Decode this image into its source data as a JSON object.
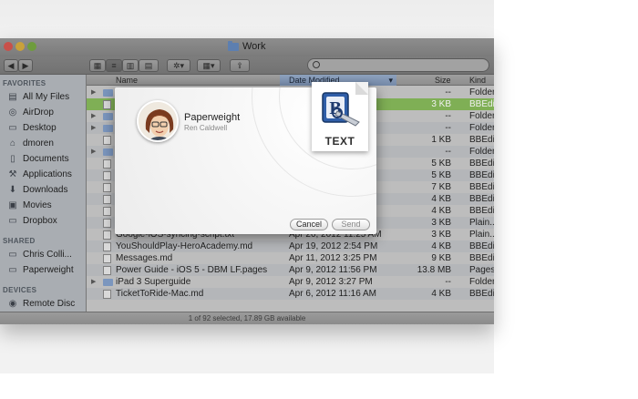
{
  "window": {
    "title": "Work"
  },
  "sidebar": {
    "sections": [
      {
        "heading": "FAVORITES",
        "items": [
          {
            "label": "All My Files",
            "icon": "all-files-icon"
          },
          {
            "label": "AirDrop",
            "icon": "airdrop-icon"
          },
          {
            "label": "Desktop",
            "icon": "desktop-icon"
          },
          {
            "label": "dmoren",
            "icon": "home-icon"
          },
          {
            "label": "Documents",
            "icon": "documents-icon"
          },
          {
            "label": "Applications",
            "icon": "applications-icon"
          },
          {
            "label": "Downloads",
            "icon": "downloads-icon"
          },
          {
            "label": "Movies",
            "icon": "movies-icon"
          },
          {
            "label": "Dropbox",
            "icon": "dropbox-icon"
          }
        ]
      },
      {
        "heading": "SHARED",
        "items": [
          {
            "label": "Chris Colli...",
            "icon": "computer-icon"
          },
          {
            "label": "Paperweight",
            "icon": "computer-icon"
          }
        ]
      },
      {
        "heading": "DEVICES",
        "items": [
          {
            "label": "Remote Disc",
            "icon": "disc-icon"
          }
        ]
      }
    ]
  },
  "columns": {
    "name": "Name",
    "date": "Date Modified",
    "size": "Size",
    "kind": "Kind"
  },
  "rows": [
    {
      "name": "",
      "date": "",
      "size": "--",
      "kind": "Folder",
      "type": "folder",
      "state": ""
    },
    {
      "name": "",
      "date": "",
      "size": "3 KB",
      "kind": "BBEdit",
      "type": "file",
      "state": "sel"
    },
    {
      "name": "",
      "date": "",
      "size": "--",
      "kind": "Folder",
      "type": "folder",
      "state": ""
    },
    {
      "name": "",
      "date": "",
      "size": "--",
      "kind": "Folder",
      "type": "folder",
      "state": ""
    },
    {
      "name": "",
      "date": "",
      "size": "1 KB",
      "kind": "BBEdit",
      "type": "file",
      "state": ""
    },
    {
      "name": "",
      "date": "",
      "size": "--",
      "kind": "Folder",
      "type": "folder",
      "state": ""
    },
    {
      "name": "",
      "date": "",
      "size": "5 KB",
      "kind": "BBEdit",
      "type": "file",
      "state": ""
    },
    {
      "name": "",
      "date": "",
      "size": "5 KB",
      "kind": "BBEdit",
      "type": "file",
      "state": ""
    },
    {
      "name": "",
      "date": "",
      "size": "7 KB",
      "kind": "BBEdit",
      "type": "file",
      "state": ""
    },
    {
      "name": "",
      "date": "",
      "size": "4 KB",
      "kind": "BBEdit",
      "type": "file",
      "state": ""
    },
    {
      "name": "",
      "date": "",
      "size": "4 KB",
      "kind": "BBEdit",
      "type": "file",
      "state": ""
    },
    {
      "name": "",
      "date": "",
      "size": "3 KB",
      "kind": "Plain...",
      "type": "file",
      "state": ""
    },
    {
      "name": "Google-iOS-syncing-script.txt",
      "date": "Apr 26, 2012 11:25 AM",
      "size": "3 KB",
      "kind": "Plain...",
      "type": "file",
      "state": ""
    },
    {
      "name": "YouShouldPlay-HeroAcademy.md",
      "date": "Apr 19, 2012 2:54 PM",
      "size": "4 KB",
      "kind": "BBEdit",
      "type": "file",
      "state": ""
    },
    {
      "name": "Messages.md",
      "date": "Apr 11, 2012 3:25 PM",
      "size": "9 KB",
      "kind": "BBEdit",
      "type": "file",
      "state": ""
    },
    {
      "name": "Power Guide - iOS 5 - DBM LF.pages",
      "date": "Apr 9, 2012 11:56 PM",
      "size": "13.8 MB",
      "kind": "Pages",
      "type": "file",
      "state": ""
    },
    {
      "name": "iPad 3 Superguide",
      "date": "Apr 9, 2012 3:27 PM",
      "size": "--",
      "kind": "Folder",
      "type": "folder",
      "state": ""
    },
    {
      "name": "TicketToRide-Mac.md",
      "date": "Apr 6, 2012 11:16 AM",
      "size": "4 KB",
      "kind": "BBEdit",
      "type": "file",
      "state": ""
    }
  ],
  "status": "1 of 92 selected, 17.89 GB available",
  "sheet": {
    "app_name": "Paperweight",
    "author": "Ren Caldwell",
    "file_label": "TEXT",
    "cancel_label": "Cancel",
    "send_label": "Send"
  },
  "colors": {
    "selection": "#7faf55",
    "sort_header": "#7d93b2",
    "sheet_bg": "#f5f5f5"
  }
}
